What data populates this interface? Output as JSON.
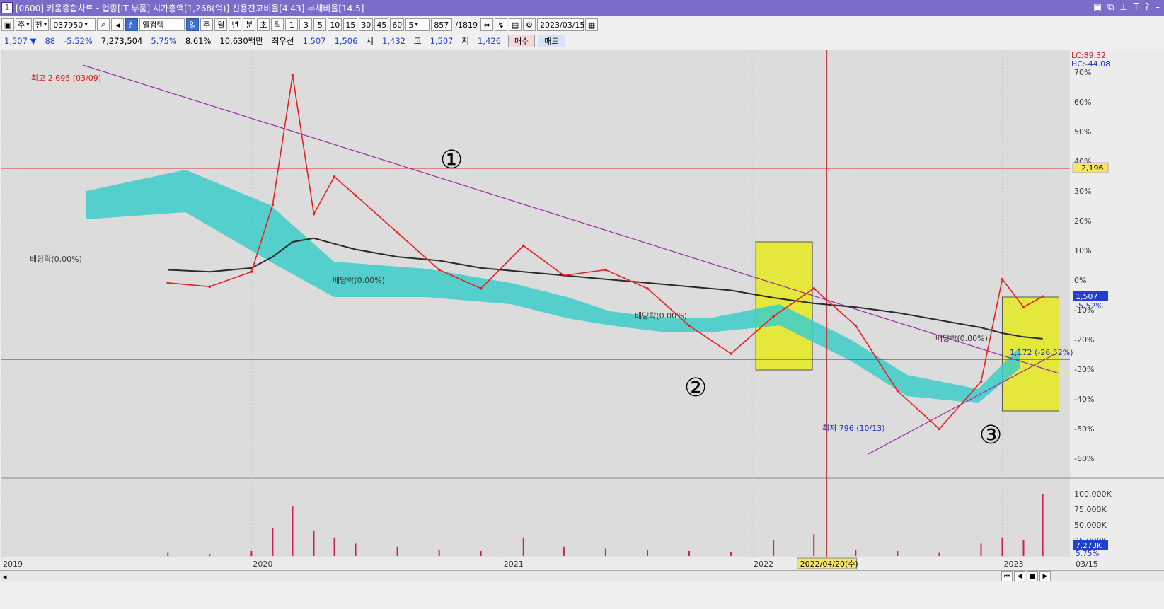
{
  "titlebar": {
    "number": "1",
    "title": "[0600] 키움종합차트 - 업종[IT 부품] 시가총액[1,268(억)] 신용잔고비율[4.43] 부채비율[14.5]",
    "icons": [
      "layout-icon",
      "window-icon",
      "pin-icon",
      "font-icon",
      "help-icon",
      "minimize-icon"
    ]
  },
  "toolbar": {
    "type_label": "주",
    "all_label": "전",
    "code": "037950",
    "stock_name": "엘컴텍",
    "stock_badge": "신",
    "periods": [
      "일",
      "주",
      "월",
      "년",
      "분",
      "초",
      "틱"
    ],
    "selected_period": "일",
    "intervals": [
      "1",
      "3",
      "5",
      "10",
      "15",
      "30",
      "45",
      "60"
    ],
    "count_value": "5",
    "range_value": "857",
    "range_total": "/1819",
    "date": "2023/03/15"
  },
  "quote": {
    "price": "1,507",
    "arrow": "▼",
    "change": "88",
    "change_rate": "-5.52%",
    "volume": "7,273,504",
    "volume_rate": "5.75%",
    "turnover": "8.61%",
    "amount": "10,630백만",
    "priority_label": "최우선",
    "ask": "1,507",
    "bid": "1,506",
    "open_label": "시",
    "open": "1,432",
    "high_label": "고",
    "high": "1,507",
    "low_label": "저",
    "low": "1,426",
    "buy_label": "매수",
    "sell_label": "매도"
  },
  "chart_data": {
    "type": "line",
    "stock": "엘컴텍",
    "title": "",
    "annotations": {
      "high_label": "최고 2,695 (03/09)",
      "low_label": "최저 796 (10/13)",
      "dividend_labels": [
        "배당락(0.00%)",
        "배당락(0.00%)",
        "배당락(0.00%)",
        "배당락(0.00%)"
      ],
      "current_label": "1,172 (-26.52%)",
      "circle_numbers": [
        "①",
        "②",
        "③"
      ],
      "lc": "LC:89.32",
      "hc": "HC:-44.08",
      "hline_value": "2,196",
      "price_tag": "1,507",
      "price_tag_rate": "-5.52%",
      "vol_tag": "7,273K",
      "vol_tag_rate": "5.75%",
      "cursor_date": "2022/04/20(수)"
    },
    "y_axis_ticks": [
      "70%",
      "60%",
      "50%",
      "40%",
      "30%",
      "20%",
      "10%",
      "0%",
      "-10%",
      "-20%",
      "-30%",
      "-40%",
      "-50%",
      "-60%"
    ],
    "volume_ticks": [
      "100,000K",
      "75,000K",
      "50,000K",
      "25,000K"
    ],
    "x_axis_ticks": [
      "2019",
      "2020",
      "2021",
      "2022",
      "2023",
      "03/15"
    ],
    "price_series": {
      "name": "",
      "x": [
        "2019-09",
        "2019-11",
        "2020-01",
        "2020-02",
        "2020-03",
        "2020-04",
        "2020-05",
        "2020-06",
        "2020-08",
        "2020-10",
        "2020-12",
        "2021-02",
        "2021-04",
        "2021-06",
        "2021-08",
        "2021-10",
        "2021-12",
        "2022-02",
        "2022-04",
        "2022-06",
        "2022-08",
        "2022-10",
        "2022-12",
        "2023-01",
        "2023-02",
        "2023-03"
      ],
      "values": [
        1580,
        1560,
        1640,
        2000,
        2695,
        1950,
        2150,
        2050,
        1850,
        1650,
        1550,
        1780,
        1620,
        1650,
        1550,
        1350,
        1200,
        1400,
        1550,
        1350,
        1000,
        796,
        1050,
        1600,
        1450,
        1507
      ]
    },
    "moving_average_240": {
      "name": "",
      "values": [
        1650,
        1640,
        1660,
        1720,
        1800,
        1820,
        1790,
        1760,
        1720,
        1700,
        1660,
        1640,
        1620,
        1600,
        1580,
        1560,
        1540,
        1500,
        1470,
        1450,
        1420,
        1380,
        1340,
        1310,
        1290,
        1280
      ]
    },
    "volume": [
      5,
      3,
      8,
      45,
      80,
      40,
      30,
      20,
      15,
      10,
      8,
      30,
      15,
      12,
      10,
      8,
      6,
      25,
      35,
      10,
      8,
      5,
      20,
      30,
      25,
      100
    ],
    "colors": {
      "price": "#e52121",
      "ma_black": "#2a2a2a",
      "ma_blue": "#2b4fd9",
      "ma_green": "#2a8a4a",
      "ma_yellow": "#f2e600",
      "cloud": "#3ccdc8",
      "trendline": "#9a2aa0",
      "highlight": "#e6ea20",
      "background": "#dcdcdc"
    }
  },
  "statusbar": {
    "nav_icons": [
      "first-icon",
      "prev-icon",
      "stop-icon",
      "next-icon"
    ]
  }
}
